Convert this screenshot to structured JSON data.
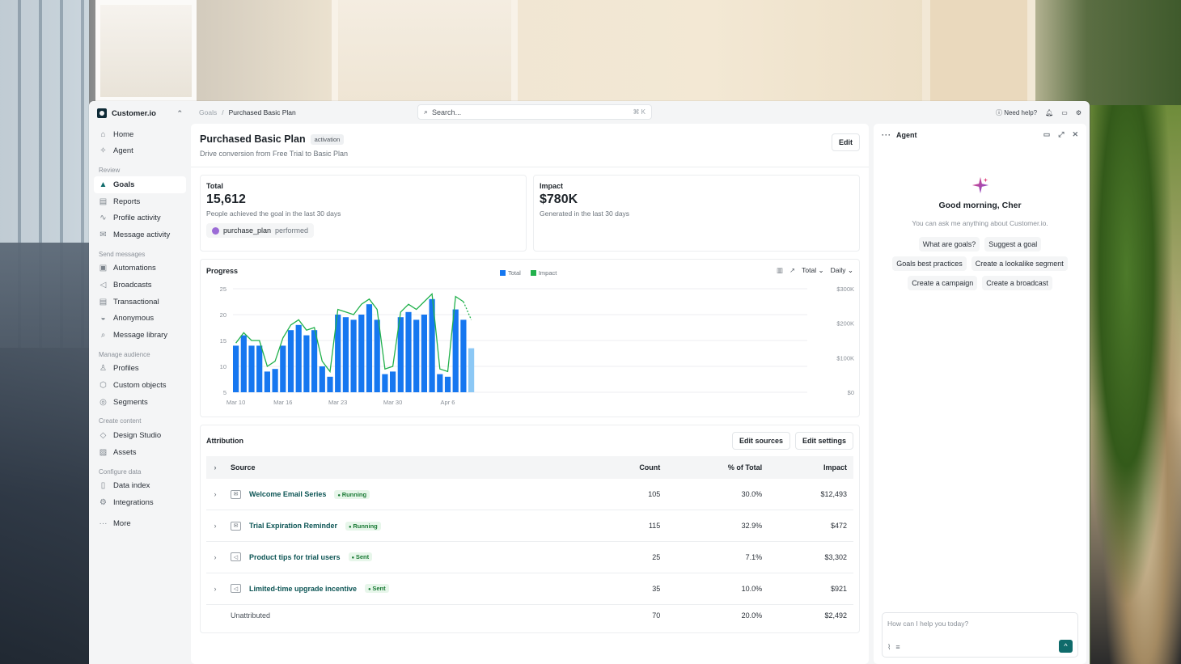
{
  "app": {
    "org_name": "Customer.io",
    "nav_main": [
      {
        "label": "Home",
        "icon": "home-icon"
      },
      {
        "label": "Agent",
        "icon": "sparkle-icon"
      }
    ],
    "sections": [
      {
        "title": "Review",
        "items": [
          {
            "label": "Goals",
            "icon": "flask-icon",
            "active": true
          },
          {
            "label": "Reports",
            "icon": "bar-chart-icon"
          },
          {
            "label": "Profile activity",
            "icon": "activity-icon"
          },
          {
            "label": "Message activity",
            "icon": "mail-icon"
          }
        ]
      },
      {
        "title": "Send messages",
        "items": [
          {
            "label": "Automations",
            "icon": "workflow-icon"
          },
          {
            "label": "Broadcasts",
            "icon": "megaphone-icon"
          },
          {
            "label": "Transactional",
            "icon": "receipt-icon"
          },
          {
            "label": "Anonymous",
            "icon": "incognito-icon"
          },
          {
            "label": "Message library",
            "icon": "search-icon"
          }
        ]
      },
      {
        "title": "Manage audience",
        "items": [
          {
            "label": "Profiles",
            "icon": "user-icon"
          },
          {
            "label": "Custom objects",
            "icon": "cube-icon"
          },
          {
            "label": "Segments",
            "icon": "segments-icon"
          }
        ]
      },
      {
        "title": "Create content",
        "items": [
          {
            "label": "Design Studio",
            "icon": "shapes-icon"
          },
          {
            "label": "Assets",
            "icon": "image-icon"
          }
        ]
      },
      {
        "title": "Configure data",
        "items": [
          {
            "label": "Data index",
            "icon": "document-icon"
          },
          {
            "label": "Integrations",
            "icon": "plug-icon"
          }
        ]
      }
    ],
    "more_label": "More"
  },
  "topbar": {
    "breadcrumb_parent": "Goals",
    "breadcrumb_sep": "/",
    "breadcrumb_current": "Purchased Basic Plan",
    "search_placeholder": "Search...",
    "search_shortcut": "⌘ K",
    "help_label": "Need help?"
  },
  "goal": {
    "title": "Purchased Basic Plan",
    "tag": "activation",
    "subtitle": "Drive conversion from Free Trial to Basic Plan",
    "edit_label": "Edit"
  },
  "stats": {
    "total": {
      "label": "Total",
      "value": "15,612",
      "desc": "People achieved the goal in the last 30 days",
      "event": "purchase_plan",
      "event_suffix": "performed"
    },
    "impact": {
      "label": "Impact",
      "value": "$780K",
      "desc": "Generated in the last 30 days"
    }
  },
  "progress": {
    "title": "Progress",
    "metric_select": "Total",
    "interval_select": "Daily"
  },
  "chart_data": {
    "type": "bar",
    "title": "Progress",
    "series": [
      {
        "name": "Total",
        "type": "bar",
        "color": "#1677f0",
        "values": [
          14,
          16,
          14,
          14,
          9,
          9.5,
          14,
          17,
          18,
          16,
          17,
          10,
          8,
          20,
          19.5,
          19,
          20,
          22,
          19,
          8.5,
          9,
          19.5,
          20.5,
          19,
          20,
          23,
          8.5,
          8,
          21,
          19,
          13.5
        ]
      },
      {
        "name": "Impact",
        "type": "line",
        "color": "#22b14c",
        "values": [
          14.5,
          16.5,
          15,
          15,
          10,
          11,
          15.5,
          18,
          19,
          17,
          17.5,
          11,
          9,
          21,
          20.5,
          20,
          22,
          23,
          21,
          9.5,
          10,
          20.5,
          22,
          21,
          22.5,
          24,
          9.5,
          9,
          23.5,
          22.5,
          19
        ]
      }
    ],
    "projected_last_point": true,
    "x_tick_labels": [
      "Mar 10",
      "Mar 16",
      "Mar 23",
      "Mar 30",
      "Apr 6"
    ],
    "x_tick_index": [
      0,
      6,
      13,
      20,
      27
    ],
    "y_ticks": [
      5,
      10,
      15,
      20,
      25
    ],
    "ylim": [
      5,
      25
    ],
    "y2_ticks": [
      "$0",
      "$100K",
      "$200K",
      "$300K"
    ],
    "legend": "top-center",
    "grid": true
  },
  "attribution": {
    "title": "Attribution",
    "edit_sources": "Edit sources",
    "edit_settings": "Edit settings",
    "columns": [
      "Source",
      "Count",
      "% of Total",
      "Impact"
    ],
    "rows": [
      {
        "name": "Welcome Email Series",
        "status": "Running",
        "icon": "email-campaign-icon",
        "count": "105",
        "pct": "30.0%",
        "impact": "$12,493"
      },
      {
        "name": "Trial Expiration Reminder",
        "status": "Running",
        "icon": "email-campaign-icon",
        "count": "115",
        "pct": "32.9%",
        "impact": "$472"
      },
      {
        "name": "Product tips for trial users",
        "status": "Sent",
        "icon": "broadcast-icon",
        "count": "25",
        "pct": "7.1%",
        "impact": "$3,302"
      },
      {
        "name": "Limited-time upgrade incentive",
        "status": "Sent",
        "icon": "broadcast-icon",
        "count": "35",
        "pct": "10.0%",
        "impact": "$921"
      }
    ],
    "unattributed": {
      "name": "Unattributed",
      "count": "70",
      "pct": "20.0%",
      "impact": "$2,492"
    }
  },
  "agent": {
    "title": "Agent",
    "greeting": "Good morning, Cher",
    "hint": "You can ask me anything about Customer.io.",
    "suggestions": [
      "What are goals?",
      "Suggest a goal",
      "Goals best practices",
      "Create a lookalike segment",
      "Create a campaign",
      "Create a broadcast"
    ],
    "input_placeholder": "How can I help you today?"
  }
}
